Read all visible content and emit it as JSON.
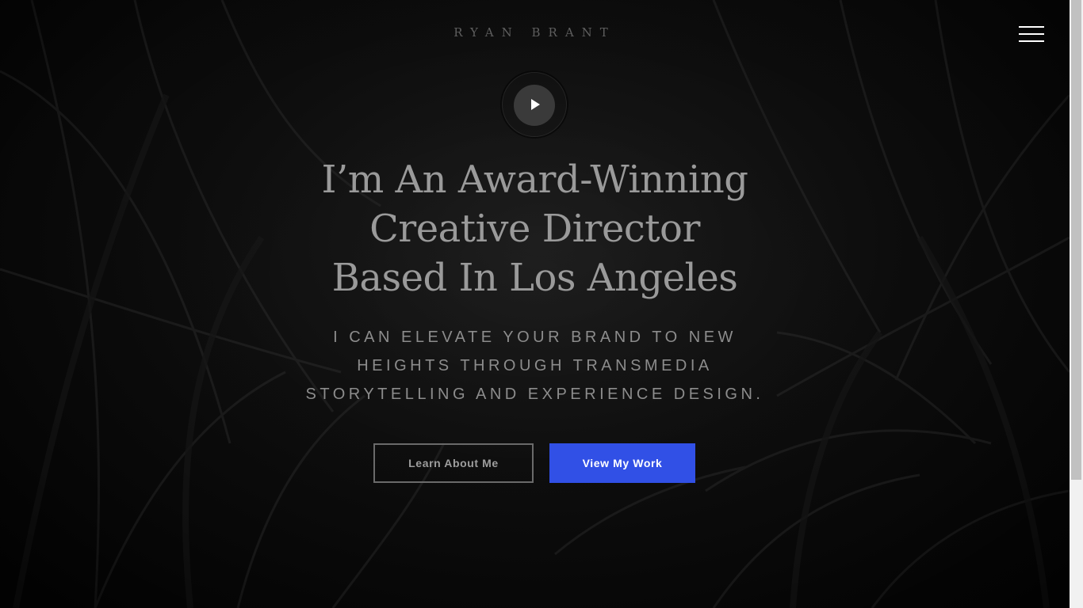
{
  "header": {
    "brand": "RYAN BRANT",
    "menu_icon": "hamburger-menu-icon"
  },
  "hero": {
    "play_icon": "play-icon",
    "headline": [
      "I’m An Award-Winning",
      "Creative Director",
      "Based In Los Angeles"
    ],
    "subheadline": [
      "I CAN ELEVATE YOUR BRAND TO NEW",
      "HEIGHTS THROUGH TRANSMEDIA",
      "STORYTELLING AND EXPERIENCE DESIGN."
    ],
    "buttons": {
      "secondary": "Learn About Me",
      "primary": "View My Work"
    }
  },
  "colors": {
    "accent": "#3150e6",
    "background": "#0b0b0b"
  }
}
